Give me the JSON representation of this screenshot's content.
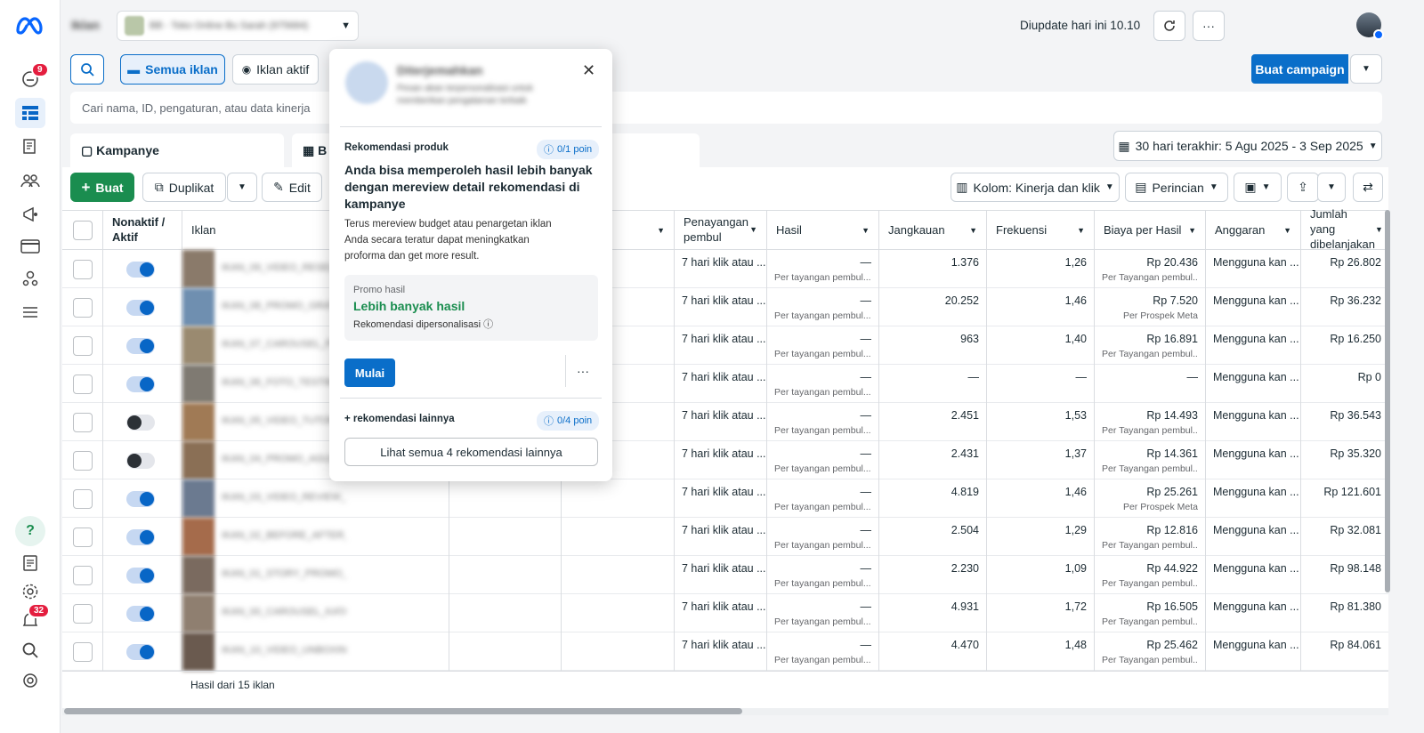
{
  "header": {
    "account_label": "Iklan",
    "account_name": "BB - Toko Online Bu Sarah (975684)",
    "updated_text": "Diupdate hari ini 10.10",
    "create_campaign_label": "Buat campaign"
  },
  "rail": {
    "notifications_badge": "9",
    "alerts_badge": "32"
  },
  "filters": {
    "all_ads_label": "Semua iklan",
    "active_ads_label": "Iklan aktif",
    "search_placeholder": "Cari nama, ID, pengaturan, atau data kinerja"
  },
  "tabs": {
    "campaigns": "Kampanye",
    "adsets_partial": "B"
  },
  "date_range": "30 hari terakhir: 5 Agu 2025 - 3 Sep 2025",
  "toolbar": {
    "create": "Buat",
    "duplicate": "Duplikat",
    "edit": "Edit",
    "columns": "Kolom: Kinerja dan klik",
    "breakdown": "Perincian"
  },
  "table": {
    "headers": {
      "toggle": "Nonaktif / Aktif",
      "ad": "Iklan",
      "attribution": "Penayangan pembul",
      "results": "Hasil",
      "reach": "Jangkauan",
      "frequency": "Frekuensi",
      "cost_per_result": "Biaya per Hasil",
      "budget": "Anggaran",
      "amount_spent": "Jumlah yang dibelanjakan"
    },
    "rows": [
      {
        "active": true,
        "name": "IKAN_09_VIDEO_RESELLER_2025",
        "attribution": "7 hari klik atau ...",
        "results": "—",
        "results_sub": "Per tayangan pembul...",
        "reach": "1.376",
        "frequency": "1,26",
        "cpr": "Rp 20.436",
        "cpr_sub": "Per Tayangan pembul...",
        "budget": "Mengguna kan ...",
        "spent": "Rp 26.802"
      },
      {
        "active": true,
        "name": "IKAN_08_PROMO_GRATIS_ONGKIR",
        "attribution": "7 hari klik atau ...",
        "results": "—",
        "results_sub": "Per tayangan pembul...",
        "reach": "20.252",
        "frequency": "1,46",
        "cpr": "Rp 7.520",
        "cpr_sub": "Per Prospek Meta",
        "budget": "Mengguna kan ...",
        "spent": "Rp 36.232"
      },
      {
        "active": true,
        "name": "IKAN_07_CAROUSEL_PRODUK",
        "attribution": "7 hari klik atau ...",
        "results": "—",
        "results_sub": "Per tayangan pembul...",
        "reach": "963",
        "frequency": "1,40",
        "cpr": "Rp 16.891",
        "cpr_sub": "Per Tayangan pembul...",
        "budget": "Mengguna kan ...",
        "spent": "Rp 16.250"
      },
      {
        "active": true,
        "name": "IKAN_06_FOTO_TESTIMONI",
        "attribution": "7 hari klik atau ...",
        "results": "—",
        "results_sub": "Per tayangan pembul...",
        "reach": "—",
        "frequency": "—",
        "cpr": "—",
        "cpr_sub": "",
        "budget": "Mengguna kan ...",
        "spent": "Rp 0"
      },
      {
        "active": false,
        "name": "IKAN_05_VIDEO_TUTORIAL_01",
        "attribution": "7 hari klik atau ...",
        "results": "—",
        "results_sub": "Per tayangan pembul...",
        "reach": "2.451",
        "frequency": "1,53",
        "cpr": "Rp 14.493",
        "cpr_sub": "Per Tayangan pembul...",
        "budget": "Mengguna kan ...",
        "spent": "Rp 36.543"
      },
      {
        "active": false,
        "name": "IKAN_04_PROMO_AGUSTUS",
        "attribution": "7 hari klik atau ...",
        "results": "—",
        "results_sub": "Per tayangan pembul...",
        "reach": "2.431",
        "frequency": "1,37",
        "cpr": "Rp 14.361",
        "cpr_sub": "Per Tayangan pembul...",
        "budget": "Mengguna kan ...",
        "spent": "Rp 35.320"
      },
      {
        "active": true,
        "name": "IKAN_03_VIDEO_REVIEW_PRODUK_BARU",
        "attribution": "7 hari klik atau ...",
        "results": "—",
        "results_sub": "Per tayangan pembul...",
        "reach": "4.819",
        "frequency": "1,46",
        "cpr": "Rp 25.261",
        "cpr_sub": "Per Prospek Meta",
        "budget": "Mengguna kan ...",
        "spent": "Rp 121.601"
      },
      {
        "active": true,
        "name": "IKAN_02_BEFORE_AFTER_2025_RESELLER",
        "attribution": "7 hari klik atau ...",
        "results": "—",
        "results_sub": "Per tayangan pembul...",
        "reach": "2.504",
        "frequency": "1,29",
        "cpr": "Rp 12.816",
        "cpr_sub": "Per Tayangan pembul...",
        "budget": "Mengguna kan ...",
        "spent": "Rp 32.081"
      },
      {
        "active": true,
        "name": "IKAN_01_STORY_PROMO_REELS_2025",
        "attribution": "7 hari klik atau ...",
        "results": "—",
        "results_sub": "Per tayangan pembul...",
        "reach": "2.230",
        "frequency": "1,09",
        "cpr": "Rp 44.922",
        "cpr_sub": "Per Tayangan pembul...",
        "budget": "Mengguna kan ...",
        "spent": "Rp 98.148"
      },
      {
        "active": true,
        "name": "IKAN_00_CAROUSEL_KATALOG_UTAMA",
        "attribution": "7 hari klik atau ...",
        "results": "—",
        "results_sub": "Per tayangan pembul...",
        "reach": "4.931",
        "frequency": "1,72",
        "cpr": "Rp 16.505",
        "cpr_sub": "Per Tayangan pembul...",
        "budget": "Mengguna kan ...",
        "spent": "Rp 81.380"
      },
      {
        "active": true,
        "name": "IKAN_10_VIDEO_UNBOXING_PRODUK_RESELLER",
        "attribution": "7 hari klik atau ...",
        "results": "—",
        "results_sub": "Per tayangan pembul...",
        "reach": "4.470",
        "frequency": "1,48",
        "cpr": "Rp 25.462",
        "cpr_sub": "Per Tayangan pembul...",
        "budget": "Mengguna kan ...",
        "spent": "Rp 84.061"
      }
    ],
    "footer": "Hasil dari 15 iklan"
  },
  "popover": {
    "page_name": "Diterjemahkan",
    "page_desc": "Pesan akan terpersonalisasi untuk memberikan pengalaman terbaik",
    "section_label": "Rekomendasi produk",
    "points": "0/1 poin",
    "headline": "Anda bisa memperoleh hasil lebih banyak dengan mereview detail rekomendasi di kampanye",
    "body": "Terus mereview budget atau penargetan iklan Anda secara teratur dapat meningkatkan proforma dan get more result.",
    "promo_label": "Promo hasil",
    "promo_title": "Lebih banyak hasil",
    "promo_sub": "Rekomendasi dipersonalisasi",
    "start_button": "Mulai",
    "more_label": "+ rekomendasi lainnya",
    "more_points": "0/4 poin",
    "see_all_button": "Lihat semua 4 rekomendasi lainnya"
  },
  "colors": {
    "accent": "#0a6ec9",
    "green": "#1a8d4f",
    "badge": "#e41e3f"
  }
}
